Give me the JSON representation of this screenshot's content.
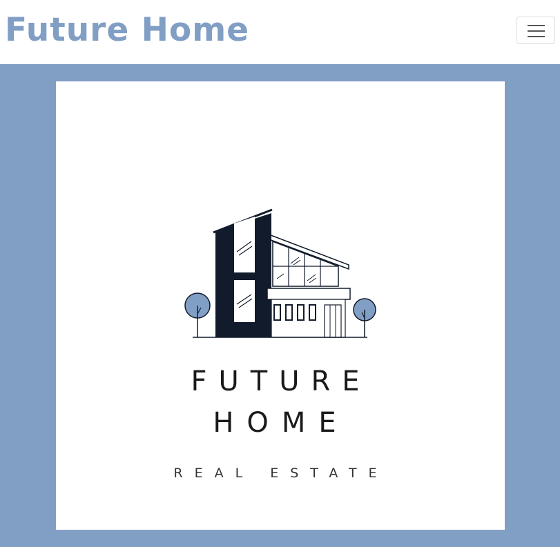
{
  "navbar": {
    "brand": "Future Home",
    "toggle_icon": "hamburger-menu-icon"
  },
  "hero": {
    "logo": {
      "line1": "FUTURE",
      "line2": "HOME",
      "tagline": "REAL ESTATE",
      "icon": "modern-house-icon"
    }
  },
  "colors": {
    "brand": "#819EC5",
    "hero_background": "#819EC5",
    "logo_dark": "#121B2C",
    "logo_text": "#1a1a1a",
    "tree_fill": "#819EC5"
  }
}
